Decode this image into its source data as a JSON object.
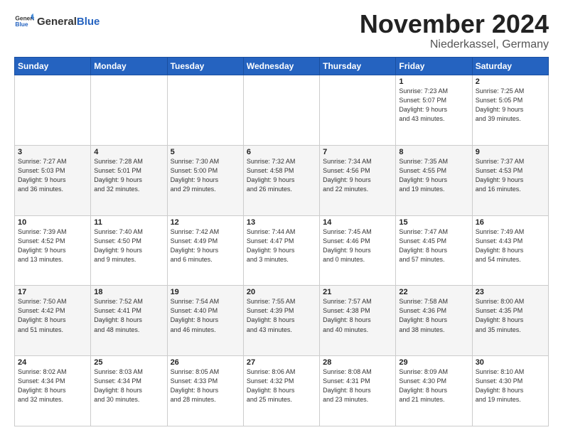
{
  "header": {
    "logo_general": "General",
    "logo_blue": "Blue",
    "month": "November 2024",
    "location": "Niederkassel, Germany"
  },
  "weekdays": [
    "Sunday",
    "Monday",
    "Tuesday",
    "Wednesday",
    "Thursday",
    "Friday",
    "Saturday"
  ],
  "weeks": [
    [
      {
        "day": "",
        "info": ""
      },
      {
        "day": "",
        "info": ""
      },
      {
        "day": "",
        "info": ""
      },
      {
        "day": "",
        "info": ""
      },
      {
        "day": "",
        "info": ""
      },
      {
        "day": "1",
        "info": "Sunrise: 7:23 AM\nSunset: 5:07 PM\nDaylight: 9 hours\nand 43 minutes."
      },
      {
        "day": "2",
        "info": "Sunrise: 7:25 AM\nSunset: 5:05 PM\nDaylight: 9 hours\nand 39 minutes."
      }
    ],
    [
      {
        "day": "3",
        "info": "Sunrise: 7:27 AM\nSunset: 5:03 PM\nDaylight: 9 hours\nand 36 minutes."
      },
      {
        "day": "4",
        "info": "Sunrise: 7:28 AM\nSunset: 5:01 PM\nDaylight: 9 hours\nand 32 minutes."
      },
      {
        "day": "5",
        "info": "Sunrise: 7:30 AM\nSunset: 5:00 PM\nDaylight: 9 hours\nand 29 minutes."
      },
      {
        "day": "6",
        "info": "Sunrise: 7:32 AM\nSunset: 4:58 PM\nDaylight: 9 hours\nand 26 minutes."
      },
      {
        "day": "7",
        "info": "Sunrise: 7:34 AM\nSunset: 4:56 PM\nDaylight: 9 hours\nand 22 minutes."
      },
      {
        "day": "8",
        "info": "Sunrise: 7:35 AM\nSunset: 4:55 PM\nDaylight: 9 hours\nand 19 minutes."
      },
      {
        "day": "9",
        "info": "Sunrise: 7:37 AM\nSunset: 4:53 PM\nDaylight: 9 hours\nand 16 minutes."
      }
    ],
    [
      {
        "day": "10",
        "info": "Sunrise: 7:39 AM\nSunset: 4:52 PM\nDaylight: 9 hours\nand 13 minutes."
      },
      {
        "day": "11",
        "info": "Sunrise: 7:40 AM\nSunset: 4:50 PM\nDaylight: 9 hours\nand 9 minutes."
      },
      {
        "day": "12",
        "info": "Sunrise: 7:42 AM\nSunset: 4:49 PM\nDaylight: 9 hours\nand 6 minutes."
      },
      {
        "day": "13",
        "info": "Sunrise: 7:44 AM\nSunset: 4:47 PM\nDaylight: 9 hours\nand 3 minutes."
      },
      {
        "day": "14",
        "info": "Sunrise: 7:45 AM\nSunset: 4:46 PM\nDaylight: 9 hours\nand 0 minutes."
      },
      {
        "day": "15",
        "info": "Sunrise: 7:47 AM\nSunset: 4:45 PM\nDaylight: 8 hours\nand 57 minutes."
      },
      {
        "day": "16",
        "info": "Sunrise: 7:49 AM\nSunset: 4:43 PM\nDaylight: 8 hours\nand 54 minutes."
      }
    ],
    [
      {
        "day": "17",
        "info": "Sunrise: 7:50 AM\nSunset: 4:42 PM\nDaylight: 8 hours\nand 51 minutes."
      },
      {
        "day": "18",
        "info": "Sunrise: 7:52 AM\nSunset: 4:41 PM\nDaylight: 8 hours\nand 48 minutes."
      },
      {
        "day": "19",
        "info": "Sunrise: 7:54 AM\nSunset: 4:40 PM\nDaylight: 8 hours\nand 46 minutes."
      },
      {
        "day": "20",
        "info": "Sunrise: 7:55 AM\nSunset: 4:39 PM\nDaylight: 8 hours\nand 43 minutes."
      },
      {
        "day": "21",
        "info": "Sunrise: 7:57 AM\nSunset: 4:38 PM\nDaylight: 8 hours\nand 40 minutes."
      },
      {
        "day": "22",
        "info": "Sunrise: 7:58 AM\nSunset: 4:36 PM\nDaylight: 8 hours\nand 38 minutes."
      },
      {
        "day": "23",
        "info": "Sunrise: 8:00 AM\nSunset: 4:35 PM\nDaylight: 8 hours\nand 35 minutes."
      }
    ],
    [
      {
        "day": "24",
        "info": "Sunrise: 8:02 AM\nSunset: 4:34 PM\nDaylight: 8 hours\nand 32 minutes."
      },
      {
        "day": "25",
        "info": "Sunrise: 8:03 AM\nSunset: 4:34 PM\nDaylight: 8 hours\nand 30 minutes."
      },
      {
        "day": "26",
        "info": "Sunrise: 8:05 AM\nSunset: 4:33 PM\nDaylight: 8 hours\nand 28 minutes."
      },
      {
        "day": "27",
        "info": "Sunrise: 8:06 AM\nSunset: 4:32 PM\nDaylight: 8 hours\nand 25 minutes."
      },
      {
        "day": "28",
        "info": "Sunrise: 8:08 AM\nSunset: 4:31 PM\nDaylight: 8 hours\nand 23 minutes."
      },
      {
        "day": "29",
        "info": "Sunrise: 8:09 AM\nSunset: 4:30 PM\nDaylight: 8 hours\nand 21 minutes."
      },
      {
        "day": "30",
        "info": "Sunrise: 8:10 AM\nSunset: 4:30 PM\nDaylight: 8 hours\nand 19 minutes."
      }
    ]
  ]
}
